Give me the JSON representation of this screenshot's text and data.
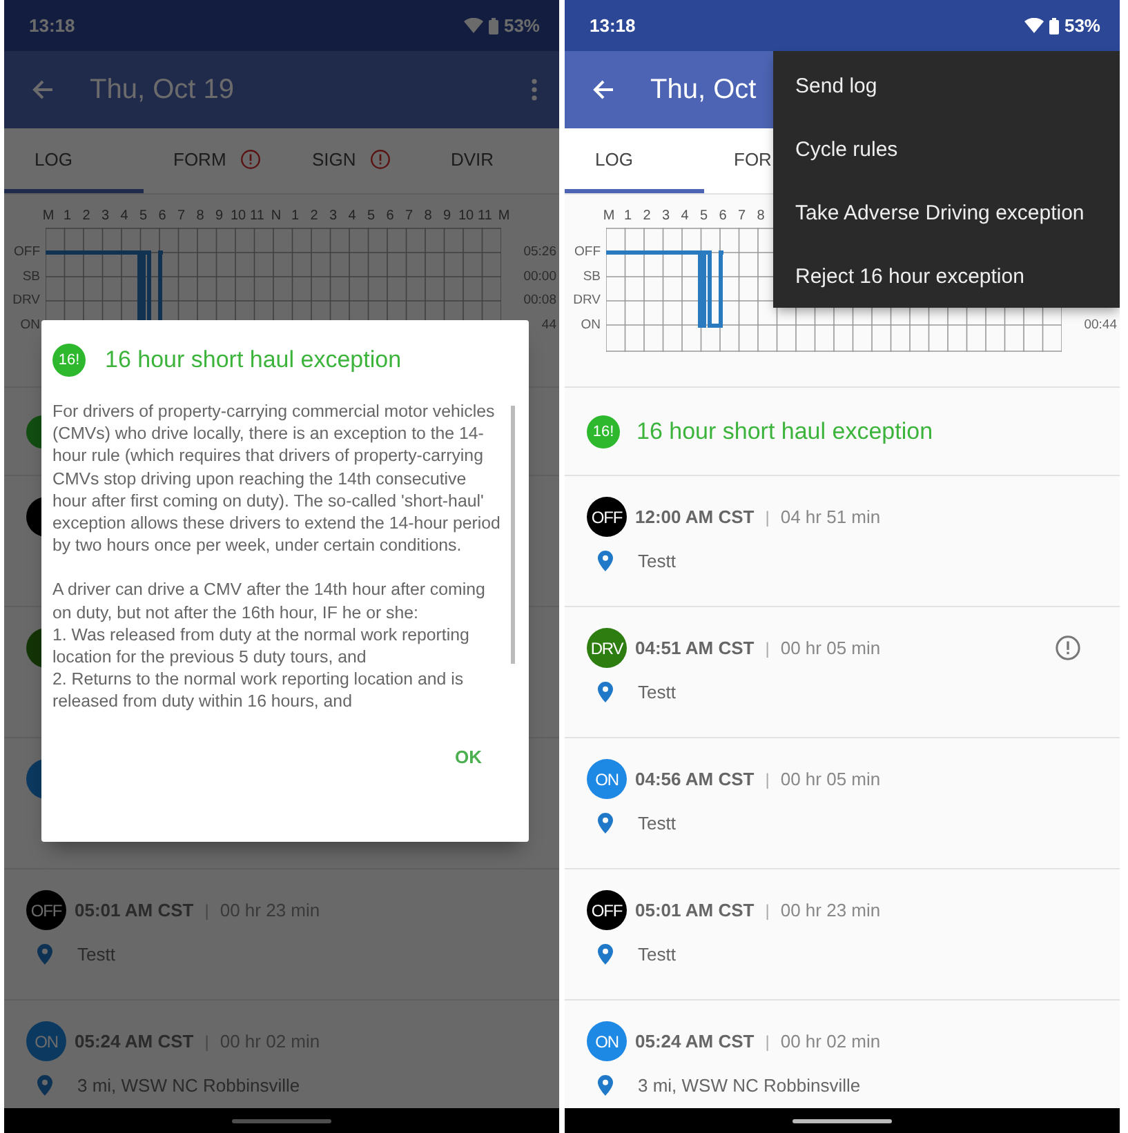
{
  "phones": [
    {
      "dimmed": true,
      "status_bar": {
        "time": "13:18",
        "battery": "53%"
      },
      "app_bar": {
        "title": "Thu, Oct 19",
        "more_button": true
      },
      "tabs": [
        {
          "label": "LOG",
          "selected": true,
          "alert": false
        },
        {
          "label": "FORM",
          "selected": false,
          "alert": true
        },
        {
          "label": "SIGN",
          "selected": false,
          "alert": true
        },
        {
          "label": "DVIR",
          "selected": false,
          "alert": false
        }
      ],
      "chart": {
        "hour_labels": [
          "M",
          "1",
          "2",
          "3",
          "4",
          "5",
          "6",
          "7",
          "8",
          "9",
          "10",
          "11",
          "N",
          "1",
          "2",
          "3",
          "4",
          "5",
          "6",
          "7",
          "8",
          "9",
          "10",
          "11",
          "M"
        ],
        "row_labels": [
          "OFF",
          "SB",
          "DRV",
          "ON"
        ],
        "totals": [
          "05:26",
          "00:00",
          "00:08",
          "44"
        ]
      },
      "covered_rows": [
        {
          "kind": "exception"
        },
        {
          "kind": "off"
        },
        {
          "kind": "drv"
        },
        {
          "kind": "on"
        }
      ],
      "entries": [
        {
          "status": "OFF",
          "kind": "off",
          "time": "05:01 AM CST",
          "separator": "|",
          "duration": "00 hr 23 min",
          "location": "Testt",
          "alert": false
        },
        {
          "status": "ON",
          "kind": "on",
          "time": "05:24 AM CST",
          "separator": "|",
          "duration": "00 hr 02 min",
          "location": "3 mi, WSW NC Robbinsville",
          "alert": false
        }
      ],
      "dialog": {
        "badge": "16!",
        "title": "16 hour short haul exception",
        "body": [
          {
            "kind": "paragraph",
            "text": "For drivers of property-carrying commercial motor vehicles (CMVs) who drive locally, there is an exception to the 14-hour rule (which requires that drivers of property-carrying CMVs stop driving upon reaching the 14th consecutive hour after first coming on duty). The so-called 'short-haul' exception allows these drivers to extend the 14-hour period by two hours once per week, under certain conditions."
          },
          {
            "kind": "paragraph",
            "text": "A driver can drive a CMV after the 14th hour after coming on duty, but not after the 16th hour, IF he or she:"
          },
          {
            "kind": "item",
            "text": "1. Was released from duty at the normal work reporting location for the previous 5 duty tours, and"
          },
          {
            "kind": "item",
            "text": "2. Returns to the normal work reporting location and is released from duty within 16 hours, and"
          }
        ],
        "ok": "OK"
      }
    },
    {
      "dimmed": false,
      "status_bar": {
        "time": "13:18",
        "battery": "53%"
      },
      "app_bar": {
        "title": "Thu, Oct"
      },
      "tabs": [
        {
          "label": "LOG",
          "selected": true,
          "alert": false
        },
        {
          "label": "FOR",
          "selected": false,
          "alert": false
        }
      ],
      "chart": {
        "hour_labels": [
          "M",
          "1",
          "2",
          "3",
          "4",
          "5",
          "6",
          "7",
          "8"
        ],
        "row_labels": [
          "OFF",
          "SB",
          "DRV",
          "ON"
        ],
        "totals": [
          "00:44"
        ]
      },
      "exception": {
        "badge": "16!",
        "title": "16 hour short haul exception"
      },
      "entries": [
        {
          "status": "OFF",
          "kind": "off",
          "time": "12:00 AM CST",
          "separator": "|",
          "duration": "04 hr 51 min",
          "location": "Testt",
          "alert": false
        },
        {
          "status": "DRV",
          "kind": "drv",
          "time": "04:51 AM CST",
          "separator": "|",
          "duration": "00 hr 05 min",
          "location": "Testt",
          "alert": true
        },
        {
          "status": "ON",
          "kind": "on",
          "time": "04:56 AM CST",
          "separator": "|",
          "duration": "00 hr 05 min",
          "location": "Testt",
          "alert": false
        },
        {
          "status": "OFF",
          "kind": "off",
          "time": "05:01 AM CST",
          "separator": "|",
          "duration": "00 hr 23 min",
          "location": "Testt",
          "alert": false
        },
        {
          "status": "ON",
          "kind": "on",
          "time": "05:24 AM CST",
          "separator": "|",
          "duration": "00 hr 02 min",
          "location": "3 mi, WSW NC Robbinsville",
          "alert": false
        }
      ],
      "menu": {
        "items": [
          "Send log",
          "Cycle rules",
          "Take Adverse Driving exception",
          "Reject 16 hour exception"
        ]
      }
    }
  ]
}
